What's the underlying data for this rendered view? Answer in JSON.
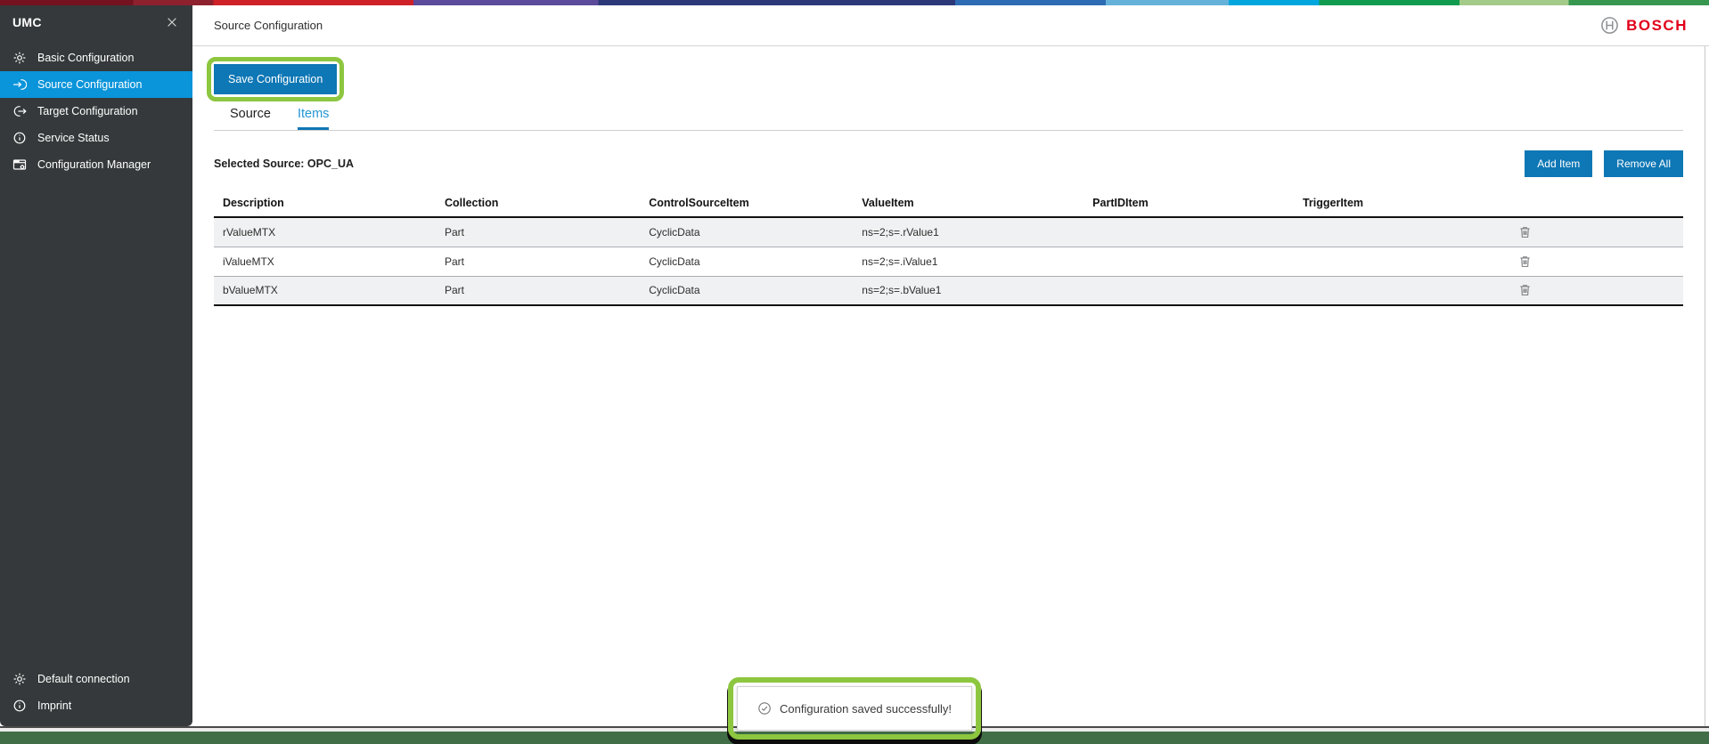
{
  "sidebar": {
    "title": "UMC",
    "items": [
      {
        "label": "Basic Configuration",
        "icon": "gear-icon",
        "active": false
      },
      {
        "label": "Source Configuration",
        "icon": "login-arrow-icon",
        "active": true
      },
      {
        "label": "Target Configuration",
        "icon": "logout-arrow-icon",
        "active": false
      },
      {
        "label": "Service Status",
        "icon": "info-icon",
        "active": false
      },
      {
        "label": "Configuration Manager",
        "icon": "config-window-icon",
        "active": false
      }
    ],
    "footer_items": [
      {
        "label": "Default connection",
        "icon": "gear-icon"
      },
      {
        "label": "Imprint",
        "icon": "info-icon"
      }
    ]
  },
  "header": {
    "page_title": "Source Configuration",
    "brand": "BOSCH"
  },
  "main": {
    "save_button": "Save Configuration",
    "tabs": [
      {
        "label": "Source",
        "active": false
      },
      {
        "label": "Items",
        "active": true
      }
    ],
    "selected_source": "Selected Source: OPC_UA",
    "add_item_button": "Add Item",
    "remove_all_button": "Remove All",
    "table": {
      "headers": [
        "Description",
        "Collection",
        "ControlSourceItem",
        "ValueItem",
        "PartIDItem",
        "TriggerItem"
      ],
      "rows": [
        {
          "description": "rValueMTX",
          "collection": "Part",
          "control_source_item": "CyclicData",
          "value_item": "ns=2;s=.rValue1",
          "part_id_item": "",
          "trigger_item": ""
        },
        {
          "description": "iValueMTX",
          "collection": "Part",
          "control_source_item": "CyclicData",
          "value_item": "ns=2;s=.iValue1",
          "part_id_item": "",
          "trigger_item": ""
        },
        {
          "description": "bValueMTX",
          "collection": "Part",
          "control_source_item": "CyclicData",
          "value_item": "ns=2;s=.bValue1",
          "part_id_item": "",
          "trigger_item": ""
        }
      ]
    }
  },
  "toast": {
    "message": "Configuration saved successfully!"
  },
  "colors": {
    "button_blue": "#0e77b5",
    "sidebar_active_blue": "#0a94da",
    "tab_active_blue": "#2196d3",
    "bosch_red": "#e1001a",
    "annotation_green": "#8dc63f",
    "bottom_bar_green": "#426e47",
    "sidebar_bg": "#35393b"
  }
}
